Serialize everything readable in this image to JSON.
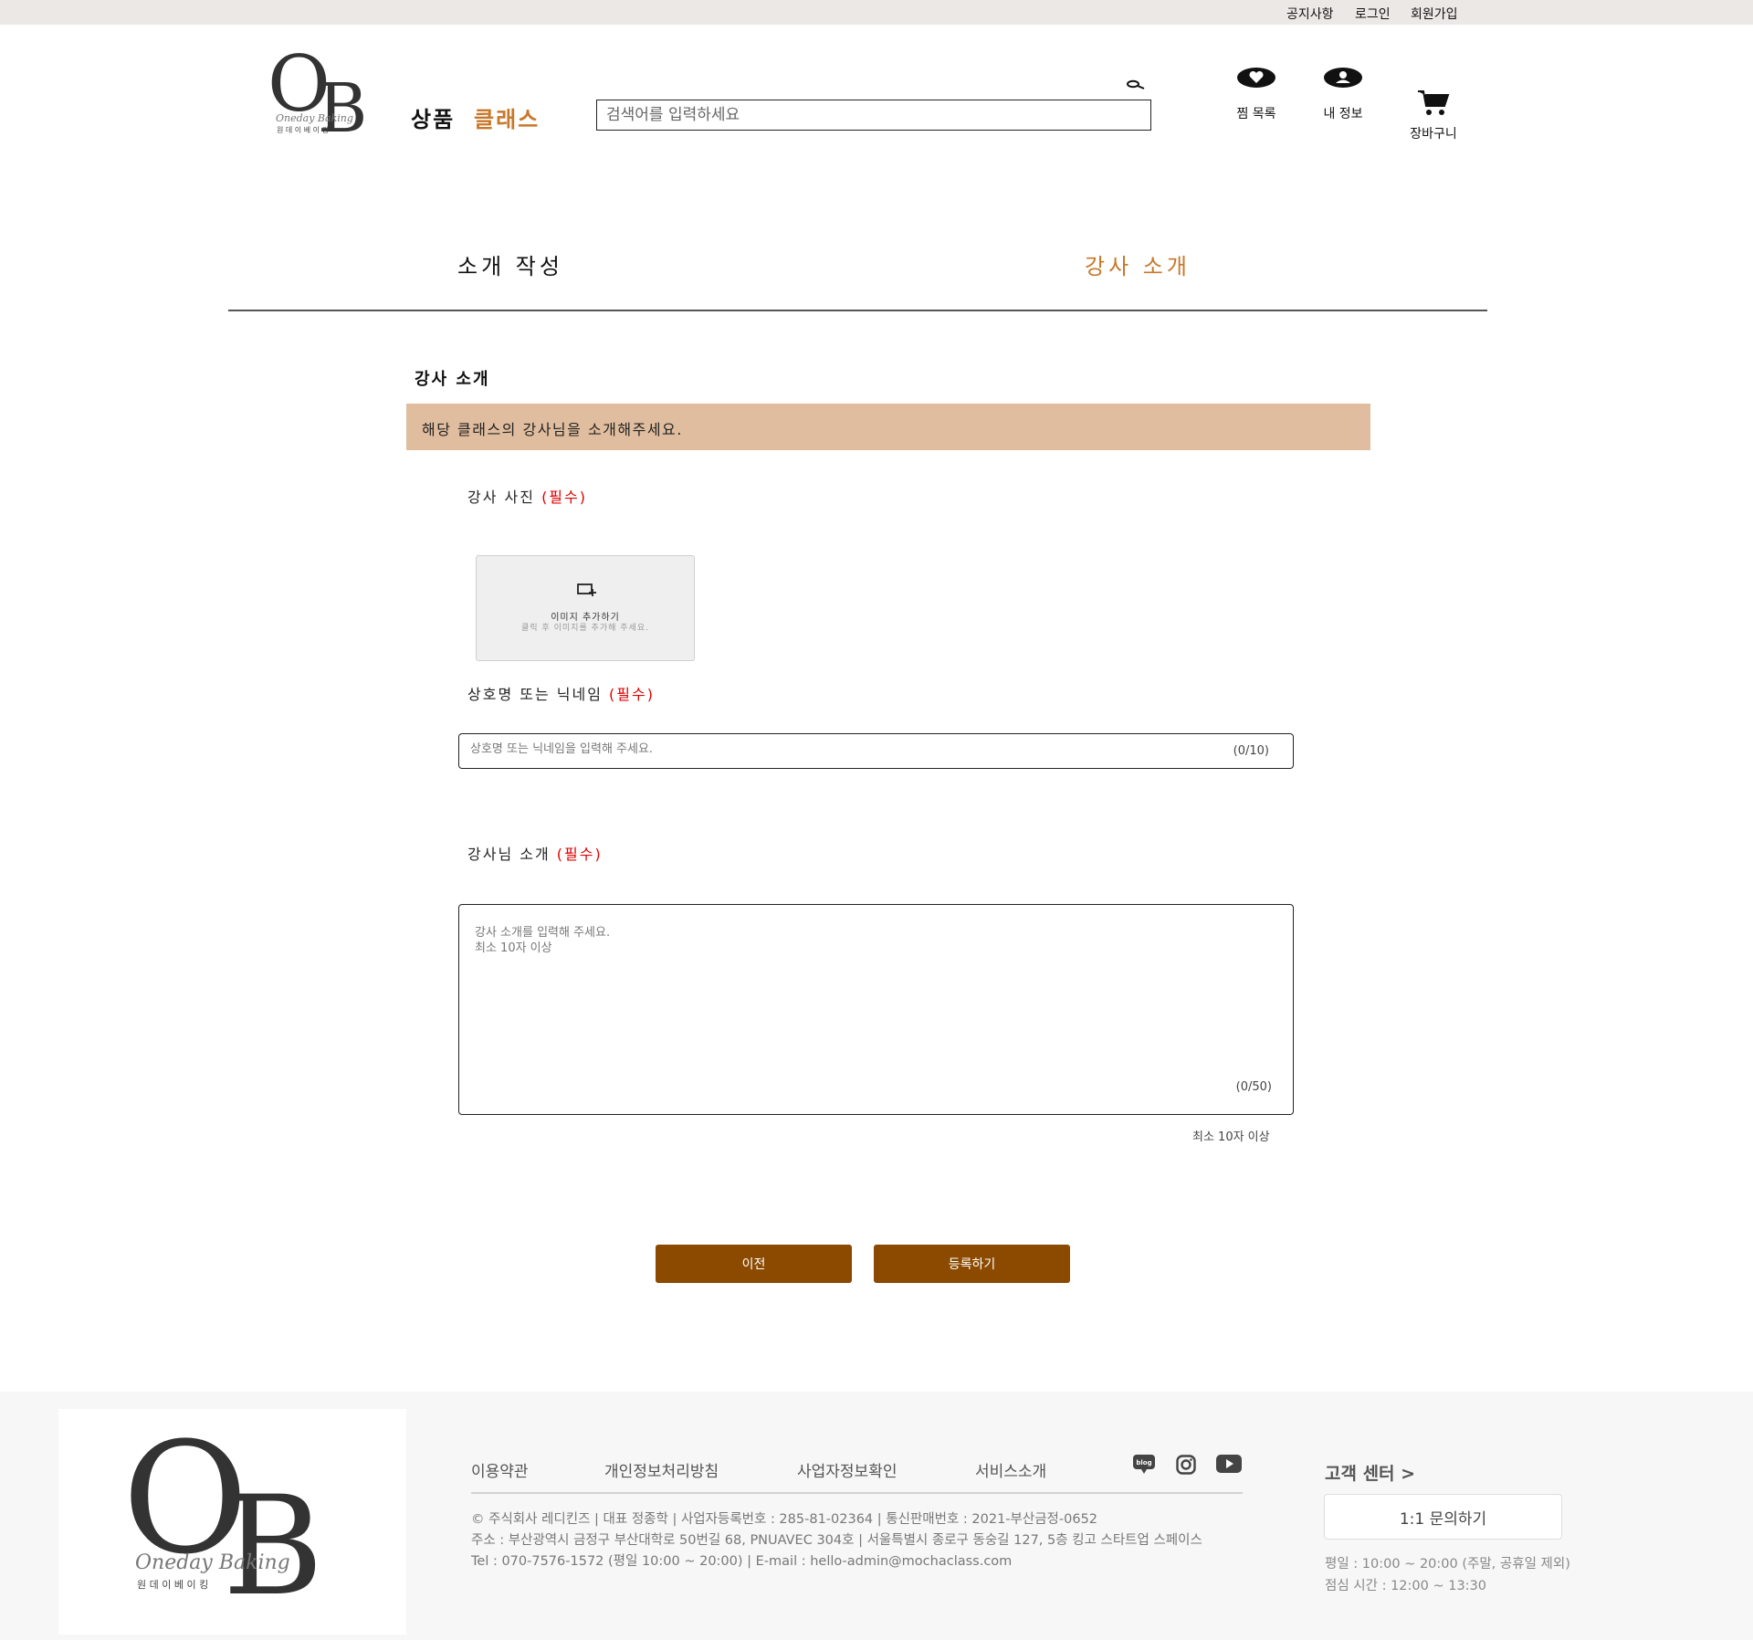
{
  "top_bar": {
    "notice": "공지사항",
    "login": "로그인",
    "signup": "회원가입"
  },
  "logo": {
    "letters_o": "O",
    "letters_b": "B",
    "script": "Oneday Baking",
    "korean": "원 데 이   베 이 킹"
  },
  "header": {
    "nav_products": "상품",
    "nav_class": "클래스",
    "search_placeholder": "검색어를 입력하세요",
    "wishlist": "찜 목록",
    "my_info": "내 정보",
    "cart": "장바구니"
  },
  "tabs": {
    "write_intro": "소개 작성",
    "instructor_intro": "강사 소개"
  },
  "section": {
    "title": "강사 소개",
    "banner": "해당 클래스의 강사님을 소개해주세요."
  },
  "form": {
    "photo_label": "강사 사진",
    "required": "(필수)",
    "upload_title": "이미지 추가하기",
    "upload_hint": "클릭 후 이미지를 추가해 주세요.",
    "nickname_label": "상호명 또는 닉네임",
    "nickname_placeholder": "상호명 또는 닉네임을 입력해 주세요.",
    "nickname_counter": "(0/10)",
    "intro_label": "강사님 소개",
    "intro_placeholder": "강사 소개를 입력해 주세요.\n최소 10자 이상",
    "intro_counter": "(0/50)",
    "intro_min_hint": "최소 10자 이상",
    "prev_button": "이전",
    "submit_button": "등록하기"
  },
  "footer": {
    "links": [
      "이용약관",
      "개인정보처리방침",
      "사업자정보확인",
      "서비스소개"
    ],
    "blog_badge": "blog",
    "company_line": "© 주식회사 레디킨즈 | 대표 정종학 | 사업자등록번호 : 285-81-02364 | 통신판매번호 : 2021-부산금정-0652",
    "address_line": "주소 : 부산광역시 금정구 부산대학로 50번길 68, PNUAVEC 304호 | 서울특별시 종로구 동숭길 127, 5층 킹고 스타트업 스페이스",
    "contact_line": "Tel : 070-7576-1572 (평일 10:00 ~ 20:00) | E-mail : hello-admin@mochaclass.com",
    "cs_title": "고객 센터 >",
    "cs_button": "1:1 문의하기",
    "cs_hours": "평일 : 10:00 ~ 20:00 (주말, 공휴일 제외)",
    "cs_lunch": "점심 시간 : 12:00 ~ 13:30"
  },
  "icons": {
    "search": "magnifier-icon",
    "wishlist": "heart-icon",
    "my_info": "person-icon",
    "cart": "cart-icon",
    "upload": "image-add-icon",
    "blog": "blog-icon",
    "instagram": "instagram-icon",
    "youtube": "youtube-icon"
  },
  "colors": {
    "accent_orange": "#c8782a",
    "banner": "#e0bd9e",
    "button": "#8b4a00",
    "required_red": "#e00000",
    "topbar": "#ece8e5"
  }
}
